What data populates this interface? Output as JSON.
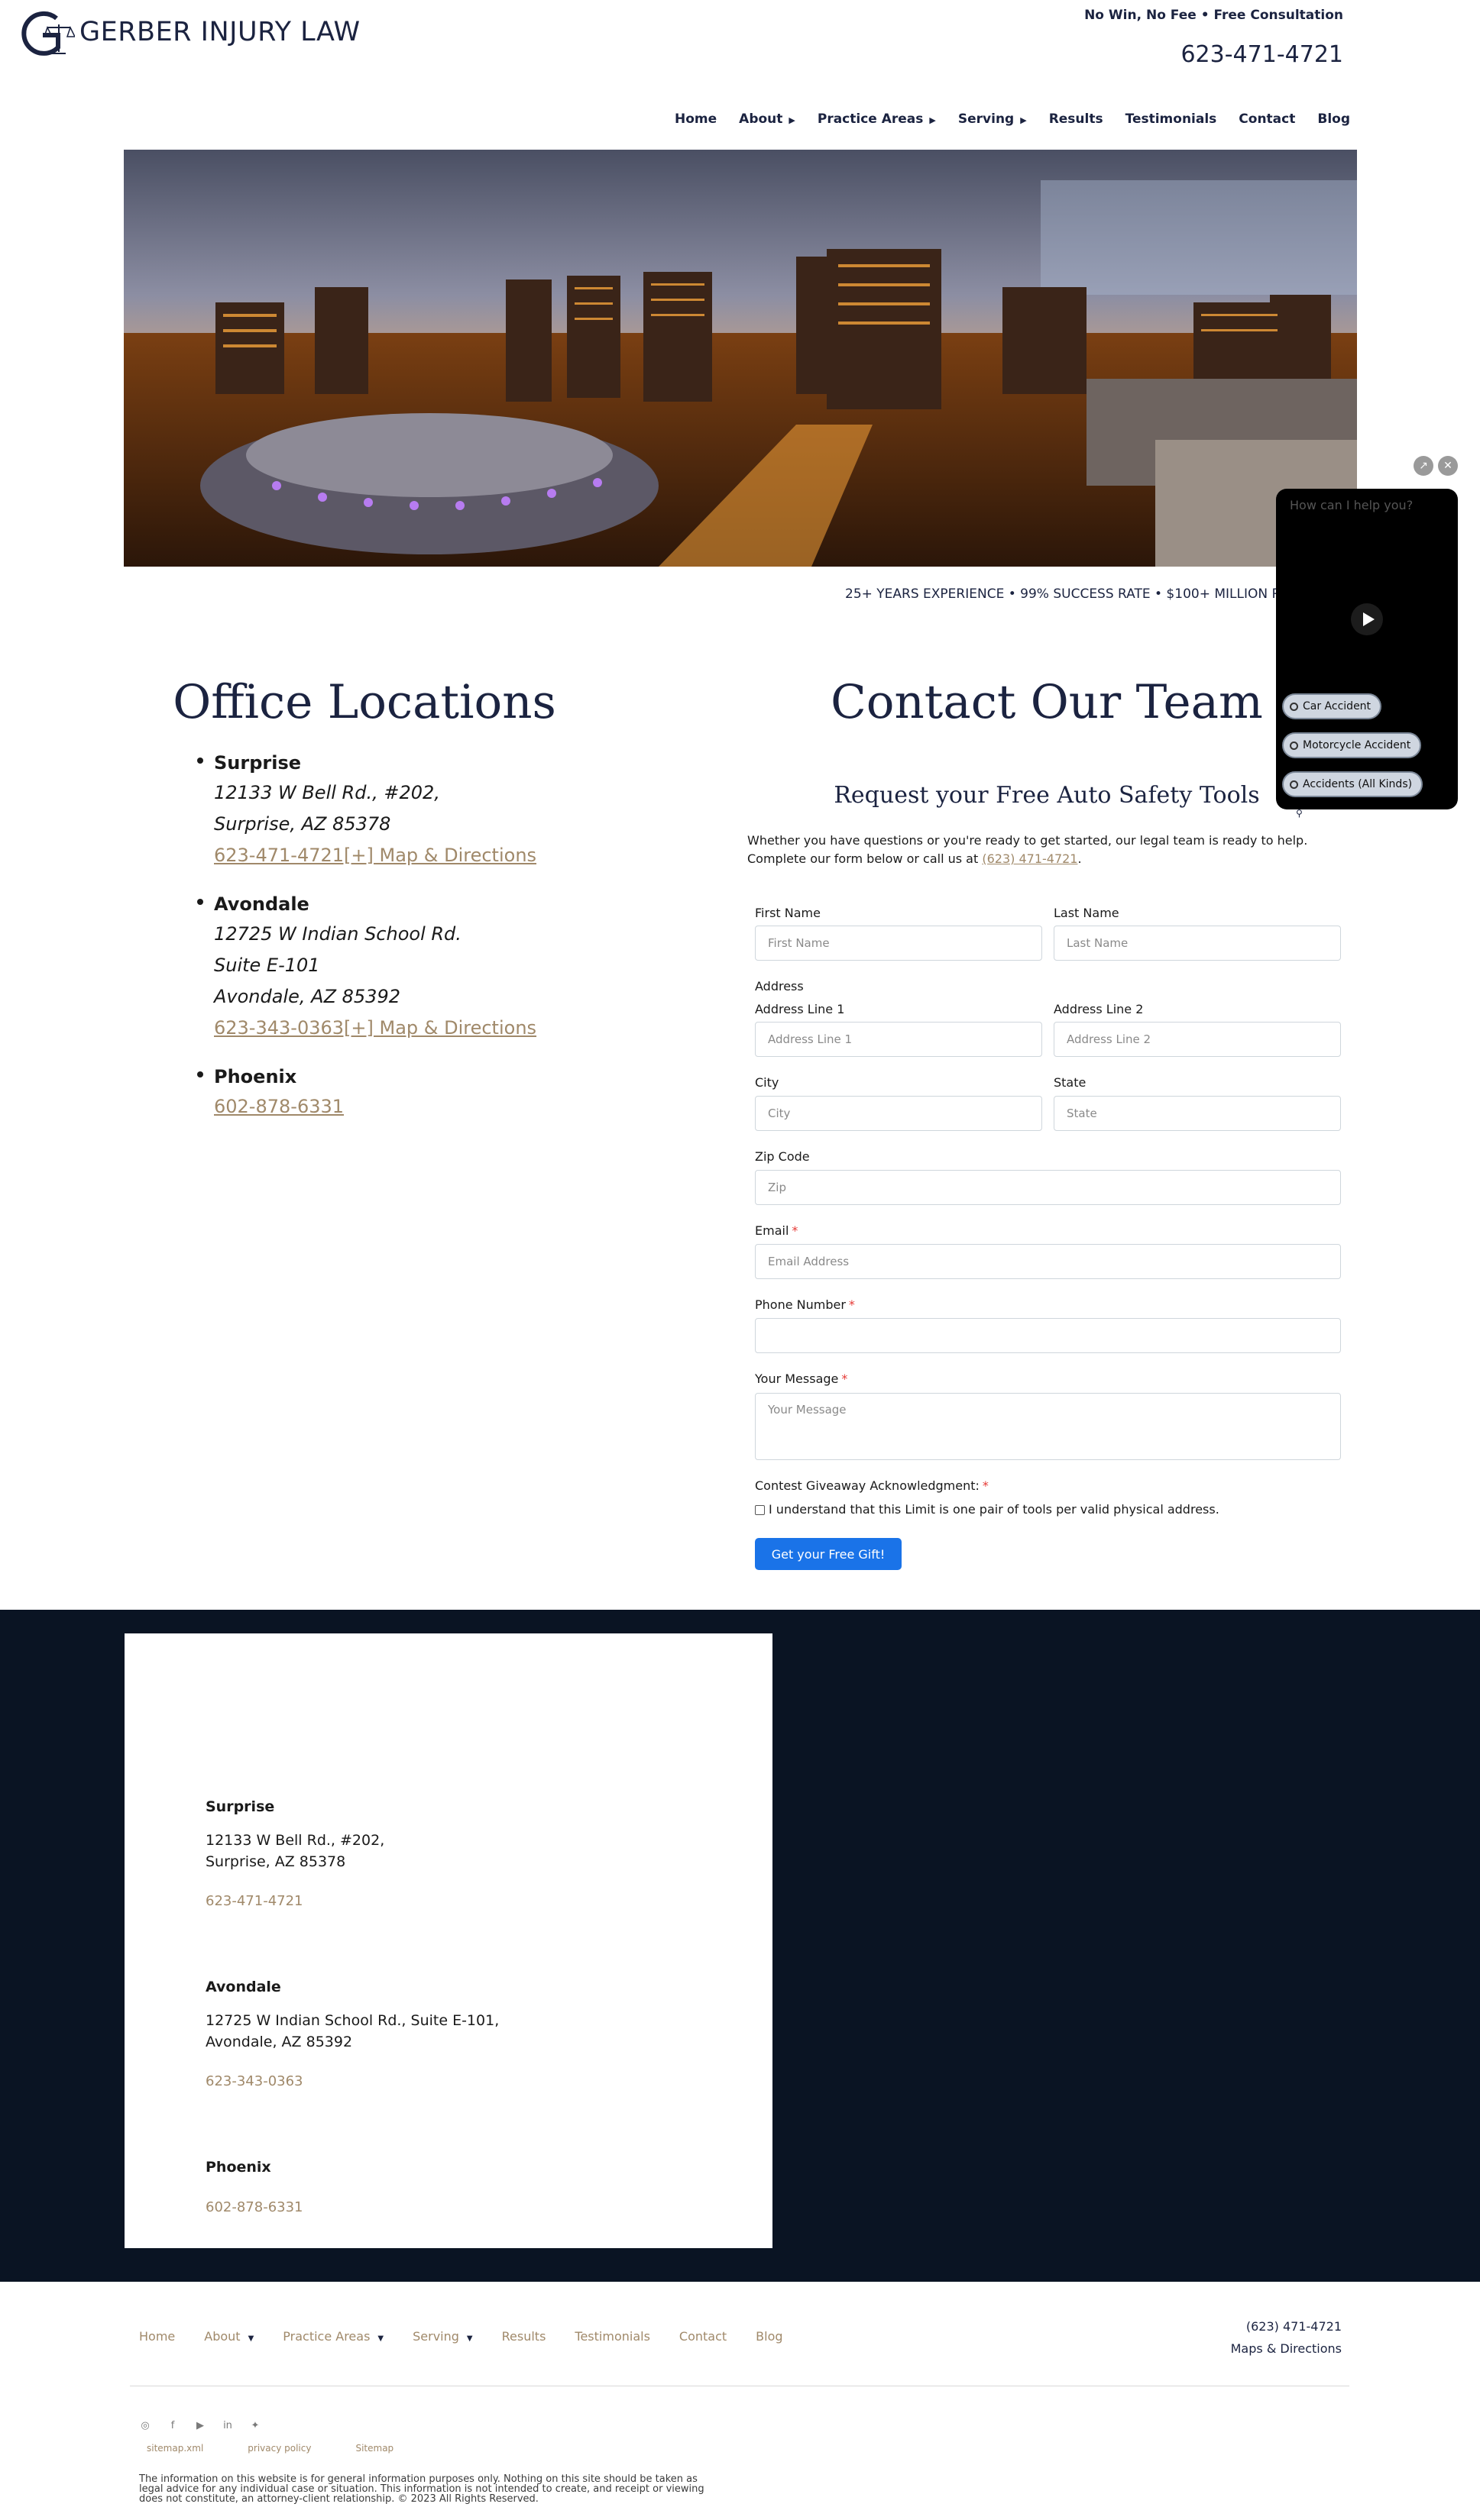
{
  "header": {
    "logo_text": "GERBER INJURY LAW",
    "tagline": "No Win, No Fee • Free Consultation",
    "phone": "623-471-4721"
  },
  "nav": [
    {
      "label": "Home",
      "has_caret": false
    },
    {
      "label": "About",
      "has_caret": true
    },
    {
      "label": "Practice Areas",
      "has_caret": true
    },
    {
      "label": "Serving",
      "has_caret": true
    },
    {
      "label": "Results",
      "has_caret": false
    },
    {
      "label": "Testimonials",
      "has_caret": false
    },
    {
      "label": "Contact",
      "has_caret": false
    },
    {
      "label": "Blog",
      "has_caret": false
    }
  ],
  "hero": {
    "stats": "25+ YEARS EXPERIENCE • 99% SUCCESS RATE • $100+ MILLION RECOVERED"
  },
  "offices": {
    "title": "Office Locations",
    "items": [
      {
        "name": "Surprise",
        "lines": [
          "12133 W Bell Rd., #202,",
          "Surprise, AZ 85378"
        ],
        "link": "623-471-4721[+] Map & Directions"
      },
      {
        "name": "Avondale",
        "lines": [
          "12725 W Indian School Rd.",
          "Suite E-101",
          "Avondale, AZ 85392"
        ],
        "link": "623-343-0363[+] Map & Directions"
      },
      {
        "name": "Phoenix",
        "lines": [],
        "link": "602-878-6331"
      }
    ]
  },
  "contact": {
    "title": "Contact Our Team",
    "request_title": "Request your Free Auto Safety Tools",
    "intro_text": "Whether you have questions or you're ready to get started, our legal team is ready to help. Complete our form below or call us at ",
    "intro_phone": "(623) 471-4721",
    "intro_end": ".",
    "form": {
      "first_name_label": "First Name",
      "first_name_placeholder": "First Name",
      "last_name_label": "Last Name",
      "last_name_placeholder": "Last Name",
      "address_label": "Address",
      "address1_label": "Address Line 1",
      "address1_placeholder": "Address Line 1",
      "address2_label": "Address Line 2",
      "address2_placeholder": "Address Line 2",
      "city_label": "City",
      "city_placeholder": "City",
      "state_label": "State",
      "state_placeholder": "State",
      "zip_label": "Zip Code",
      "zip_placeholder": "Zip",
      "email_label": "Email",
      "email_placeholder": "Email Address",
      "phone_label": "Phone Number",
      "phone_placeholder": "",
      "message_label": "Your Message",
      "message_placeholder": "Your Message",
      "ack_label": "Contest Giveaway Acknowledgment:",
      "ack_checkbox": "I understand that this Limit is one pair of tools per valid physical address.",
      "required_mark": "*",
      "submit_label": "Get your Free Gift!"
    }
  },
  "chat": {
    "prompt": "How can I help you?",
    "chips": [
      "Car Accident",
      "Motorcycle Accident",
      "Accidents (All Kinds)"
    ]
  },
  "locations_card": {
    "items": [
      {
        "name": "Surprise",
        "lines": [
          "12133 W Bell Rd., #202,",
          "Surprise, AZ 85378"
        ],
        "phone": "623-471-4721"
      },
      {
        "name": "Avondale",
        "lines": [
          "12725 W Indian School Rd., Suite E-101,",
          "Avondale, AZ 85392"
        ],
        "phone": "623-343-0363"
      },
      {
        "name": "Phoenix",
        "lines": [],
        "phone": "602-878-6331"
      }
    ]
  },
  "footer": {
    "nav": [
      {
        "label": "Home",
        "has_caret": false
      },
      {
        "label": "About",
        "has_caret": true
      },
      {
        "label": "Practice Areas",
        "has_caret": true
      },
      {
        "label": "Serving",
        "has_caret": true
      },
      {
        "label": "Results",
        "has_caret": false
      },
      {
        "label": "Testimonials",
        "has_caret": false
      },
      {
        "label": "Contact",
        "has_caret": false
      },
      {
        "label": "Blog",
        "has_caret": false
      }
    ],
    "phone": "(623) 471-4721",
    "maps": "Maps & Directions",
    "socials": [
      "instagram-icon",
      "facebook-icon",
      "youtube-icon",
      "linkedin-icon",
      "twitter-icon"
    ],
    "links": [
      "sitemap.xml",
      "privacy policy",
      "Sitemap"
    ],
    "disclaimer": "The information on this website is for general information purposes only. Nothing on this site should be taken as legal advice for any individual case or situation. This information is not intended to create, and receipt or viewing does not constitute, an attorney-client relationship. © 2023 All Rights Reserved."
  },
  "colors": {
    "navy": "#1b2340",
    "gold_link": "#a0896a",
    "dark_band": "#0a1423",
    "button_blue": "#1a73e8",
    "required_red": "#e53935"
  }
}
